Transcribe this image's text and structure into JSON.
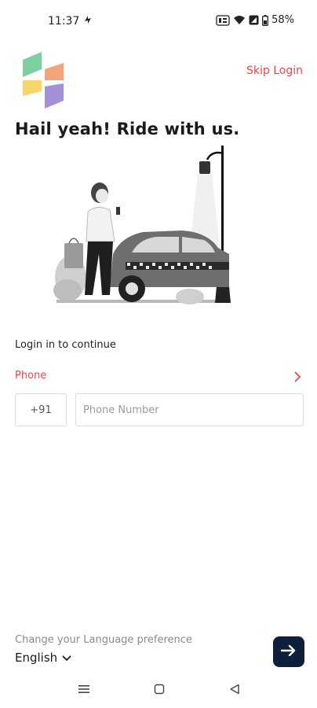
{
  "status_bar": {
    "time": "11:37",
    "battery": "58%"
  },
  "header": {
    "skip_label": "Skip Login"
  },
  "hero": {
    "headline": "Hail yeah! Ride with us."
  },
  "login": {
    "caption": "Login in to continue",
    "phone_label": "Phone",
    "country_code": "+91",
    "phone_placeholder": "Phone Number"
  },
  "footer": {
    "language_caption": "Change your Language preference",
    "language_value": "English"
  },
  "colors": {
    "accent": "#e8474c",
    "button_bg": "#0f1e3a"
  }
}
